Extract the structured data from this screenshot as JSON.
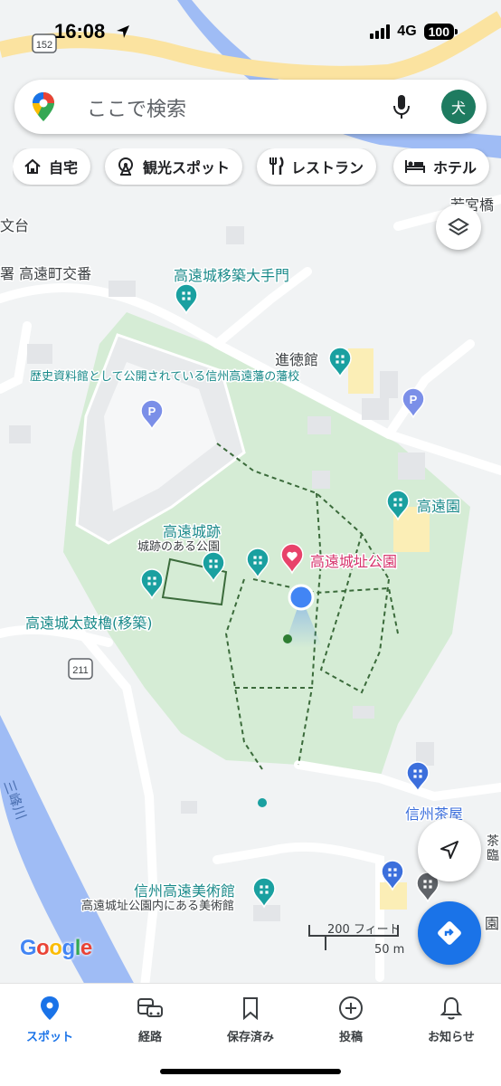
{
  "status": {
    "time": "16:08",
    "network": "4G",
    "battery": "100"
  },
  "search": {
    "placeholder": "ここで検索",
    "avatar_letter": "犬"
  },
  "chips": [
    {
      "label": "自宅",
      "icon": "home-icon"
    },
    {
      "label": "観光スポット",
      "icon": "ferris-wheel-icon"
    },
    {
      "label": "レストラン",
      "icon": "fork-knife-icon"
    },
    {
      "label": "ホテル",
      "icon": "bed-icon"
    }
  ],
  "map": {
    "labels": {
      "bunkyo": "文台",
      "koban": "署 高遠町交番",
      "otemon": "高遠城移築大手門",
      "shintokukan": "進徳館",
      "hanko": "歴史資料館として公開されている信州高遠藩の藩校",
      "kouenkaku": "高遠園",
      "castle_ruins": "高遠城跡",
      "castle_ruins_sub": "城跡のある公園",
      "castle_park": "高遠城址公園",
      "taiko": "高遠城太鼓櫓(移築)",
      "route": "211",
      "shinshu_chaya": "信州茶屋",
      "museum": "信州高遠美術館",
      "museum_sub": "高遠城址公園内にある美術館",
      "river": "三峰川",
      "top_right": "若宮橋",
      "road_top": "152",
      "right_cut1": "茶",
      "right_cut2": "臨",
      "right_cut3": "園"
    }
  },
  "scale": {
    "imperial": "200 フィート",
    "metric": "50 m"
  },
  "brand": {
    "letters": [
      "G",
      "o",
      "o",
      "g",
      "l",
      "e"
    ]
  },
  "bottom_nav": [
    {
      "label": "スポット",
      "icon": "location-pin-icon",
      "active": true
    },
    {
      "label": "経路",
      "icon": "commute-icon",
      "active": false
    },
    {
      "label": "保存済み",
      "icon": "bookmark-icon",
      "active": false
    },
    {
      "label": "投稿",
      "icon": "add-circle-icon",
      "active": false
    },
    {
      "label": "お知らせ",
      "icon": "bell-icon",
      "active": false
    }
  ],
  "colors": {
    "park": "#d5ecd5",
    "road": "#ffffff",
    "river": "#9fbcf5",
    "highway": "#fde9a6",
    "poi_teal": "#1aa0a0",
    "poi_pink": "#e8426a",
    "parking": "#7b8fe8",
    "shop": "#3c6fdc",
    "blue": "#1a73e8"
  }
}
